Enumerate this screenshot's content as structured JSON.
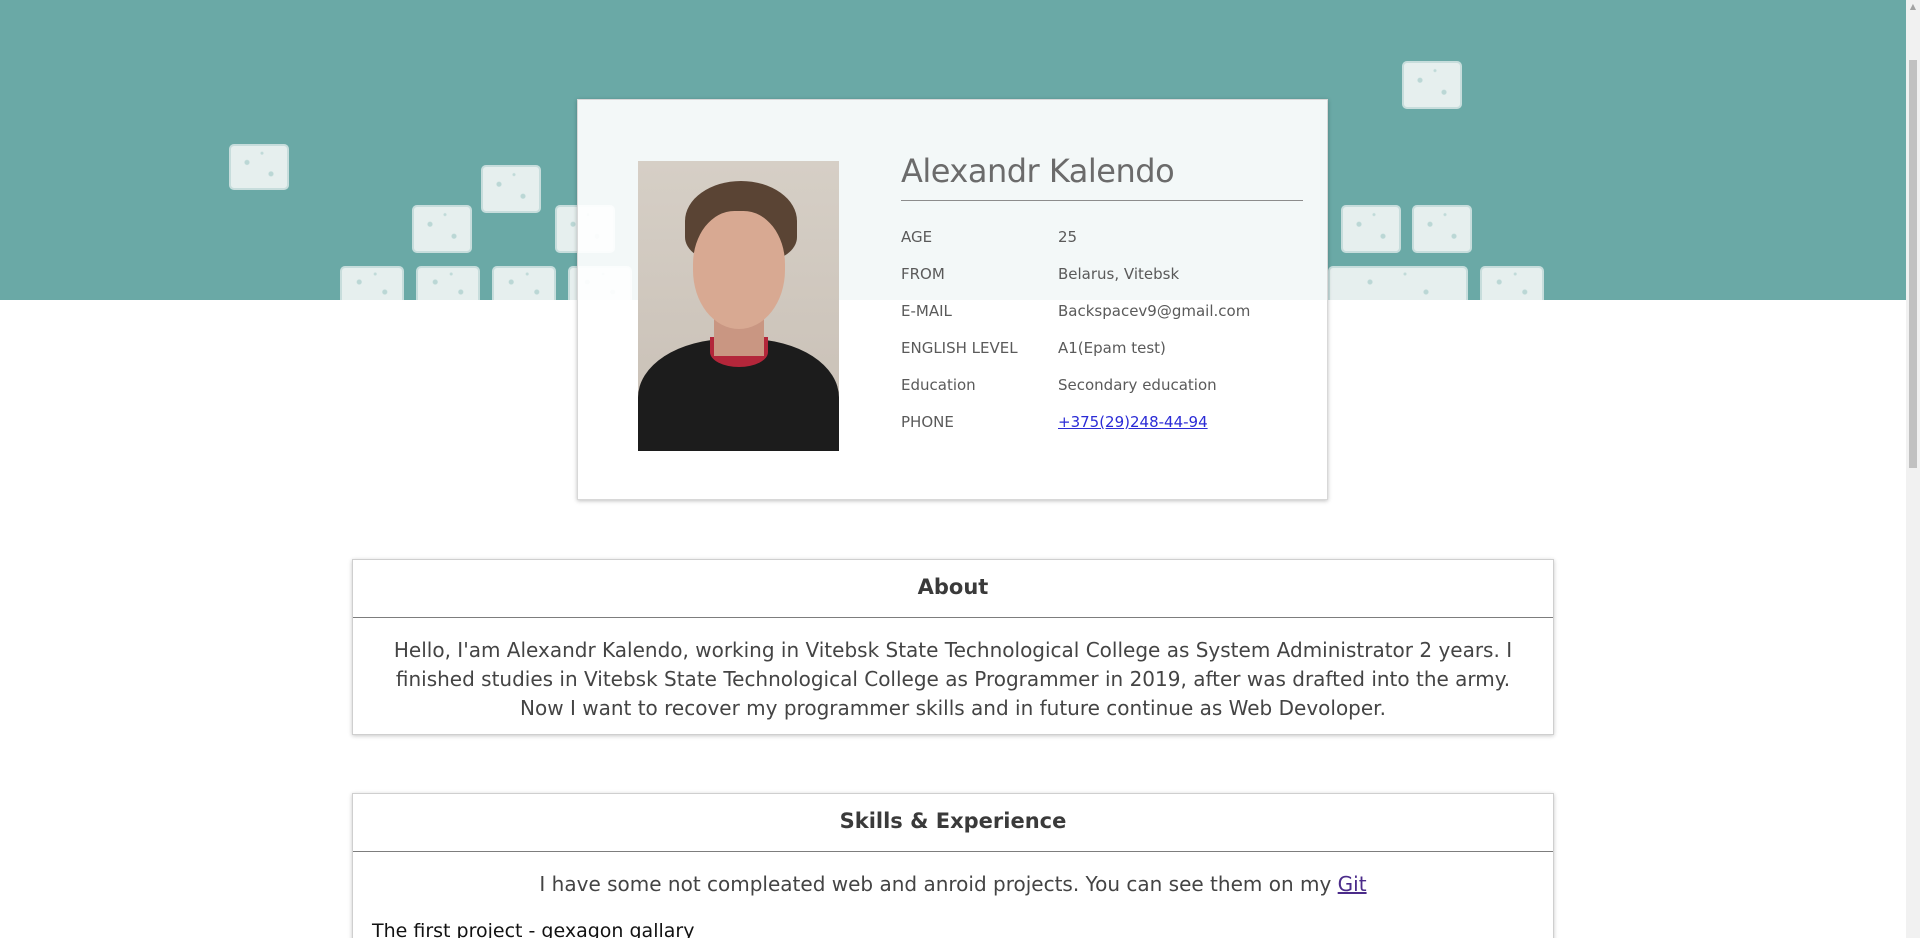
{
  "profile": {
    "name": "Alexandr Kalendo",
    "rows": [
      {
        "label": "AGE",
        "value": "25"
      },
      {
        "label": "FROM",
        "value": "Belarus, Vitebsk"
      },
      {
        "label": "E-MAIL",
        "value": "Backspacev9@gmail.com"
      },
      {
        "label": "ENGLISH LEVEL",
        "value": "A1(Epam test)"
      },
      {
        "label": "Education",
        "value": "Secondary education"
      },
      {
        "label": "PHONE",
        "value": "+375(29)248-44-94"
      }
    ]
  },
  "about": {
    "title": "About",
    "text": "Hello, I'am Alexandr Kalendo, working in Vitebsk State Technological College as System Administrator 2 years. I finished studies in Vitebsk State Technological College as Programmer in 2019, after was drafted into the army. Now I want to recover my programmer skills and in future continue as Web Devoloper."
  },
  "skills": {
    "title": "Skills & Experience",
    "intro": "I have some not compleated web and anroid projects. You can see them on my",
    "git_link": "Git",
    "first_project": "The first project - gexagon gallary"
  },
  "colors": {
    "hero_background": "#6aa9a6",
    "link": "#2b2bd6",
    "visited_link": "#4b2b8a"
  },
  "icons": {
    "header_background": "keyboard-keys-illustration",
    "scroll_up": "chevron-up-icon"
  }
}
